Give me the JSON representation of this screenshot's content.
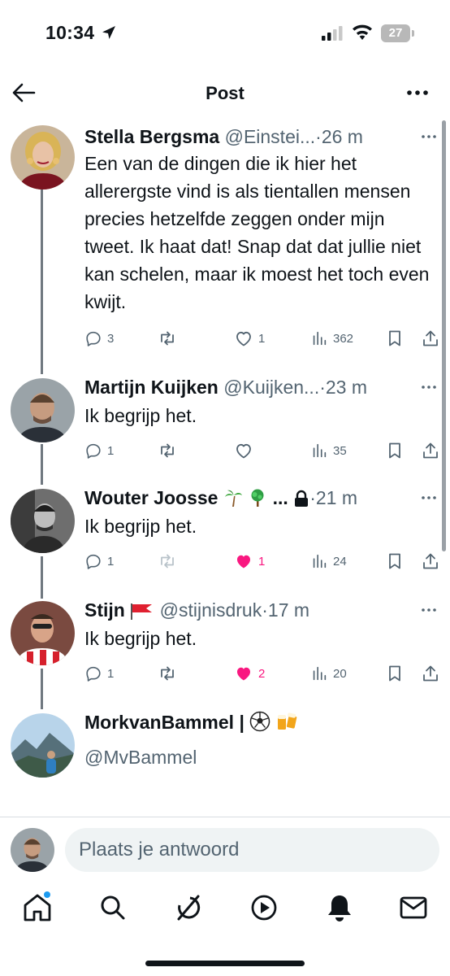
{
  "status_bar": {
    "time": "10:34",
    "battery": "27"
  },
  "header": {
    "title": "Post"
  },
  "tweets": [
    {
      "name": "Stella Bergsma",
      "handle": "@Einstei...",
      "time": "26 m",
      "text": "Een van de dingen die ik hier het allerergste vind is als tientallen mensen precies hetzelfde zeggen onder mijn tweet. Ik haat dat! Snap dat dat jullie niet kan schelen, maar ik moest het toch even kwijt.",
      "replies": "3",
      "retweets": "",
      "likes": "1",
      "views": "362",
      "liked": false
    },
    {
      "name": "Martijn Kuijken",
      "handle": "@Kuijken...",
      "time": "23 m",
      "text": "Ik begrijp het.",
      "replies": "1",
      "retweets": "",
      "likes": "",
      "views": "35",
      "liked": false
    },
    {
      "name": "Wouter Joosse",
      "handle": "...",
      "time": "21 m",
      "text": "Ik begrijp het.",
      "replies": "1",
      "retweets": "",
      "likes": "1",
      "views": "24",
      "liked": true
    },
    {
      "name": "Stijn",
      "handle": "@stijnisdruk",
      "time": "17 m",
      "text": "Ik begrijp het.",
      "replies": "1",
      "retweets": "",
      "likes": "2",
      "views": "20",
      "liked": true
    },
    {
      "name": "MorkvanBammel |",
      "handle": "@MvBammel"
    }
  ],
  "reply": {
    "placeholder": "Plaats je antwoord"
  },
  "colors": {
    "like": "#f91880",
    "secondary_text": "#536471",
    "accent": "#1d9bf0"
  },
  "icons": [
    "back-arrow-icon",
    "more-icon",
    "reply-icon",
    "retweet-icon",
    "like-icon",
    "views-icon",
    "bookmark-icon",
    "share-icon",
    "lock-icon",
    "home-icon",
    "search-icon",
    "grok-icon",
    "video-icon",
    "notifications-icon",
    "messages-icon"
  ]
}
